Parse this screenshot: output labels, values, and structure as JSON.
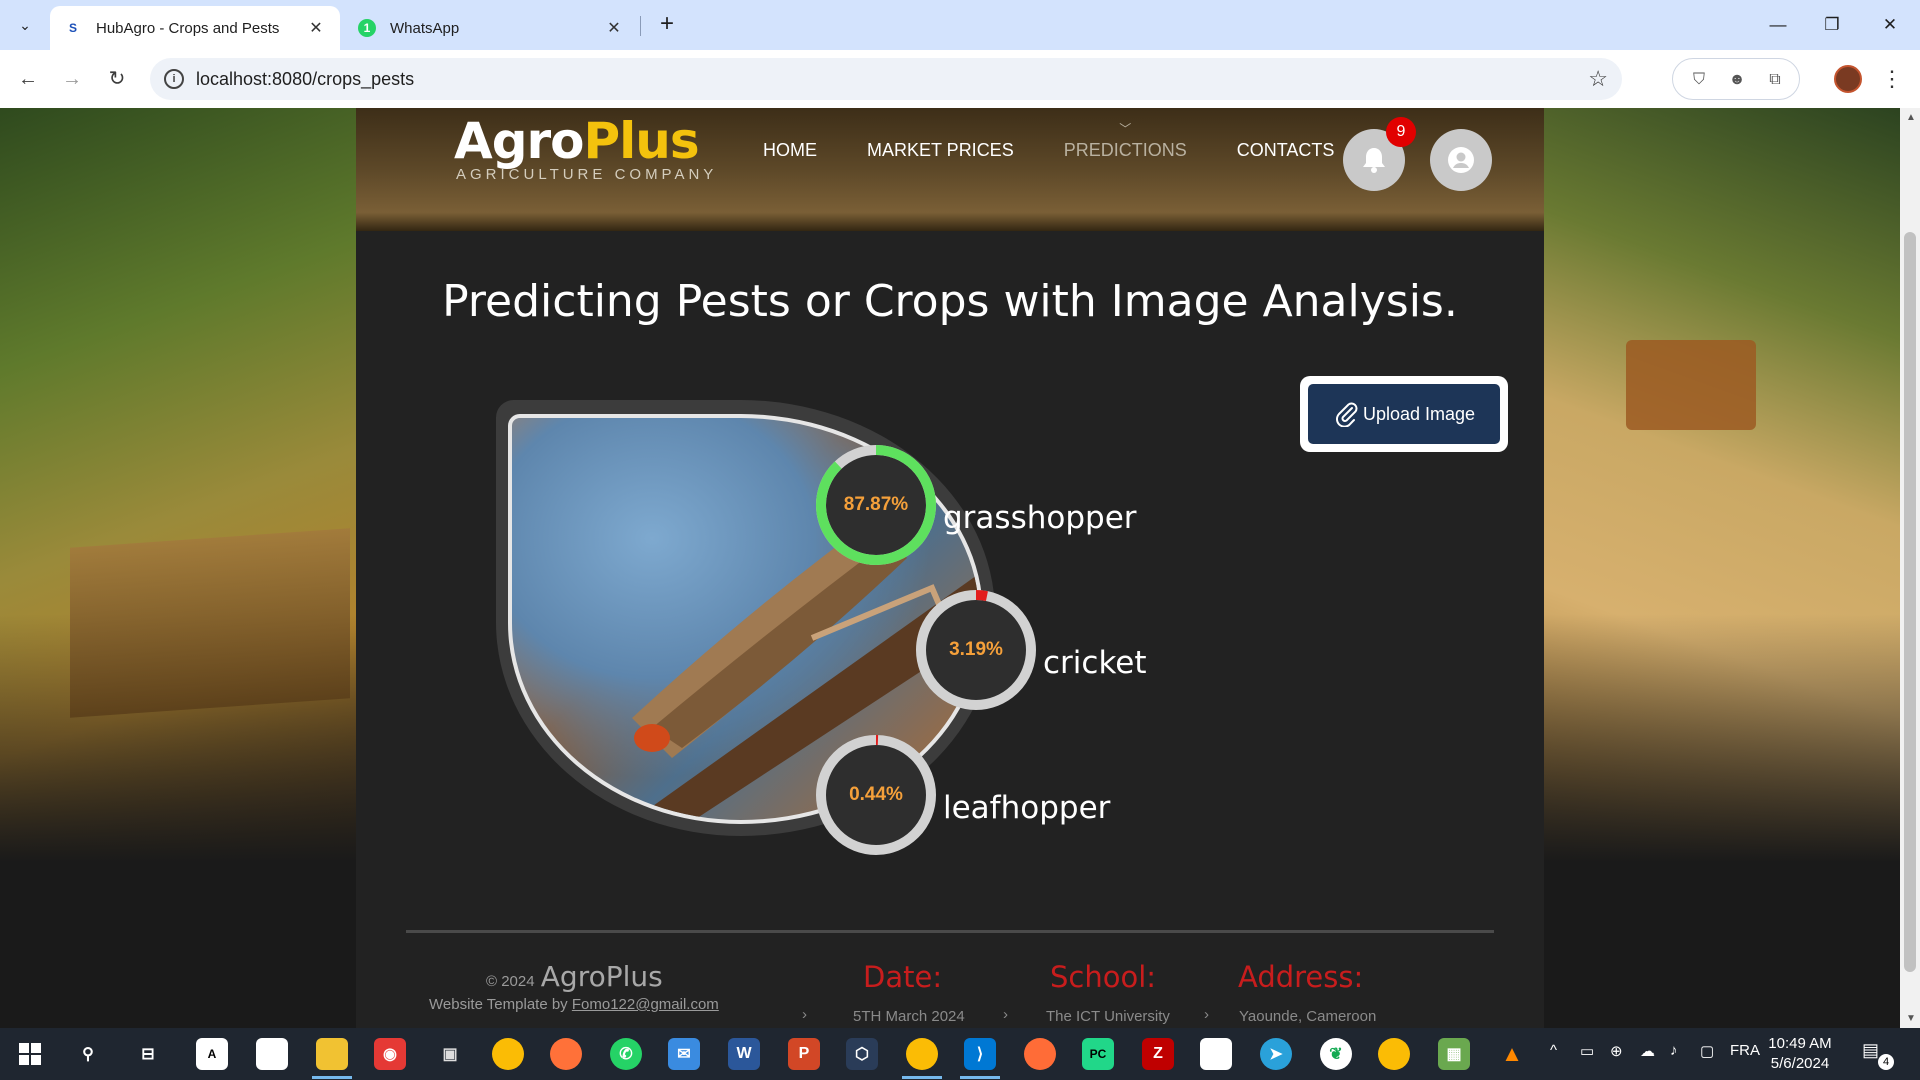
{
  "browser": {
    "tabs": [
      {
        "title": "HubAgro - Crops and Pests",
        "favicon": "S"
      },
      {
        "title": "WhatsApp",
        "favicon": "1"
      }
    ],
    "url": "localhost:8080/crops_pests"
  },
  "site": {
    "logo_agro": "Agro",
    "logo_plus": "Plus",
    "logo_sub": "AGRICULTURE COMPANY",
    "nav": [
      "HOME",
      "MARKET PRICES",
      "PREDICTIONS",
      "CONTACTS"
    ],
    "current_nav": "PREDICTIONS",
    "notification_count": "9",
    "heading": "Predicting Pests or Crops with Image Analysis.",
    "upload_label": "Upload Image",
    "predictions": [
      {
        "label": "grasshopper",
        "percent_text": "87.87%",
        "fraction": 0.8787,
        "color": "#5ee05e"
      },
      {
        "label": "cricket",
        "percent_text": "3.19%",
        "fraction": 0.0319,
        "color": "#e21d1d"
      },
      {
        "label": "leafhopper",
        "percent_text": "0.44%",
        "fraction": 0.0044,
        "color": "#e21d1d"
      }
    ]
  },
  "footer": {
    "copyright": "© 2024",
    "brand": "AgroPlus",
    "template_prefix": "Website Template by",
    "template_email": "Fomo122@gmail.com",
    "date_label": "Date:",
    "date_value": "5TH March 2024",
    "school_label": "School:",
    "school_value": "The ICT University",
    "address_label": "Address:",
    "address_value": "Yaounde, Cameroon"
  },
  "taskbar": {
    "language": "FRA",
    "time": "10:49 AM",
    "date": "5/6/2024",
    "notifications": "4"
  }
}
